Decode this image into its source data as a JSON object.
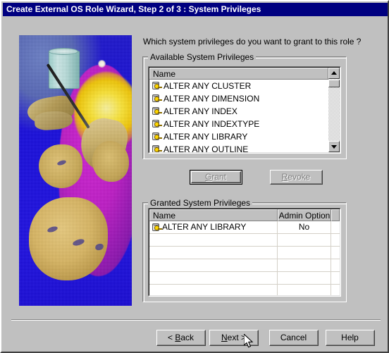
{
  "window": {
    "title": "Create External OS Role Wizard, Step 2 of 3 : System Privileges",
    "titlebar_color": "#000080",
    "face_color": "#c0c0c0"
  },
  "artwork": {
    "name": "oracle-wizard-illustration",
    "description": "Magic wand illustration with database cylinder and masks"
  },
  "main": {
    "question": "Which system privileges do you want to grant to this role ?"
  },
  "available_group": {
    "label": "Available System Privileges",
    "column_header": "Name",
    "items": [
      "ALTER ANY CLUSTER",
      "ALTER ANY DIMENSION",
      "ALTER ANY INDEX",
      "ALTER ANY INDEXTYPE",
      "ALTER ANY LIBRARY",
      "ALTER ANY OUTLINE"
    ],
    "scrollbar": {
      "up_arrow": "scroll-up-icon",
      "down_arrow": "scroll-down-icon"
    }
  },
  "transfer_buttons": {
    "grant": {
      "label": "Grant",
      "accel": "G",
      "enabled": false,
      "default": true
    },
    "revoke": {
      "label": "Revoke",
      "accel": "R",
      "enabled": false,
      "default": false
    }
  },
  "granted_group": {
    "label": "Granted System Privileges",
    "columns": [
      "Name",
      "Admin Option",
      ""
    ],
    "rows": [
      {
        "name": "ALTER ANY LIBRARY",
        "admin_option": "No"
      }
    ],
    "empty_row_count": 5
  },
  "footer": {
    "buttons": [
      {
        "label": "< Back",
        "accel": "B"
      },
      {
        "label": "Next >",
        "accel": "N"
      },
      {
        "label": "Cancel",
        "accel": ""
      },
      {
        "label": "Help",
        "accel": ""
      }
    ]
  },
  "cursor": {
    "type": "arrow-pointer"
  }
}
